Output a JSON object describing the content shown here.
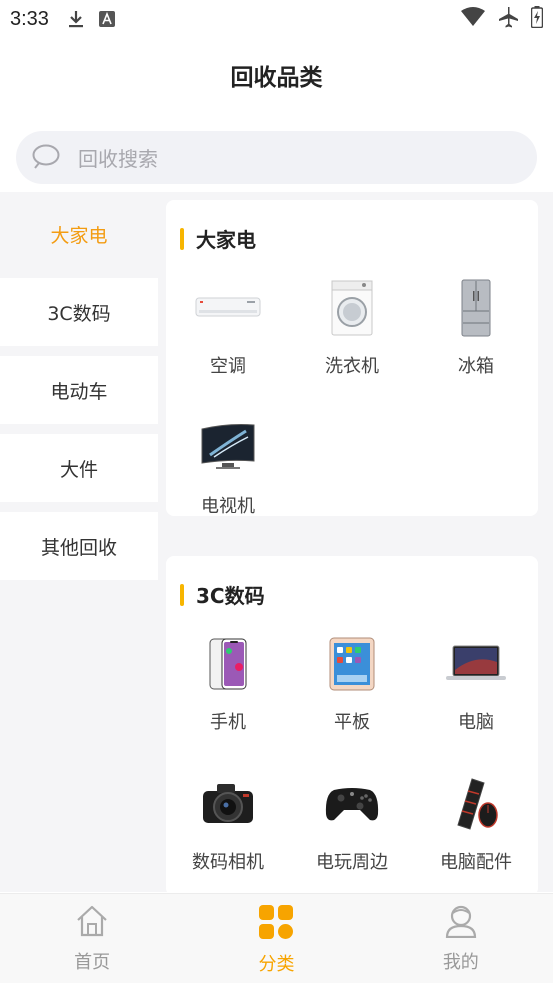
{
  "status_bar": {
    "time": "3:33"
  },
  "header": {
    "title": "回收品类"
  },
  "search": {
    "placeholder": "回收搜索"
  },
  "sidebar": {
    "items": [
      {
        "label": "大家电",
        "active": true
      },
      {
        "label": "3C数码",
        "active": false
      },
      {
        "label": "电动车",
        "active": false
      },
      {
        "label": "大件",
        "active": false
      },
      {
        "label": "其他回收",
        "active": false
      }
    ]
  },
  "sections": [
    {
      "title": "大家电",
      "items": [
        {
          "label": "空调",
          "icon": "air-conditioner-icon"
        },
        {
          "label": "洗衣机",
          "icon": "washing-machine-icon"
        },
        {
          "label": "冰箱",
          "icon": "refrigerator-icon"
        },
        {
          "label": "电视机",
          "icon": "tv-icon"
        }
      ]
    },
    {
      "title": "3C数码",
      "items": [
        {
          "label": "手机",
          "icon": "phone-icon"
        },
        {
          "label": "平板",
          "icon": "tablet-icon"
        },
        {
          "label": "电脑",
          "icon": "laptop-icon"
        },
        {
          "label": "数码相机",
          "icon": "camera-icon"
        },
        {
          "label": "电玩周边",
          "icon": "gamepad-icon"
        },
        {
          "label": "电脑配件",
          "icon": "keyboard-mouse-icon"
        }
      ]
    }
  ],
  "bottom_nav": {
    "items": [
      {
        "label": "首页",
        "icon": "home-icon",
        "active": false
      },
      {
        "label": "分类",
        "icon": "category-icon",
        "active": true
      },
      {
        "label": "我的",
        "icon": "profile-icon",
        "active": false
      }
    ]
  },
  "colors": {
    "accent": "#f7a400",
    "accent_bar": "#f7b500",
    "background": "#f5f5f7"
  }
}
